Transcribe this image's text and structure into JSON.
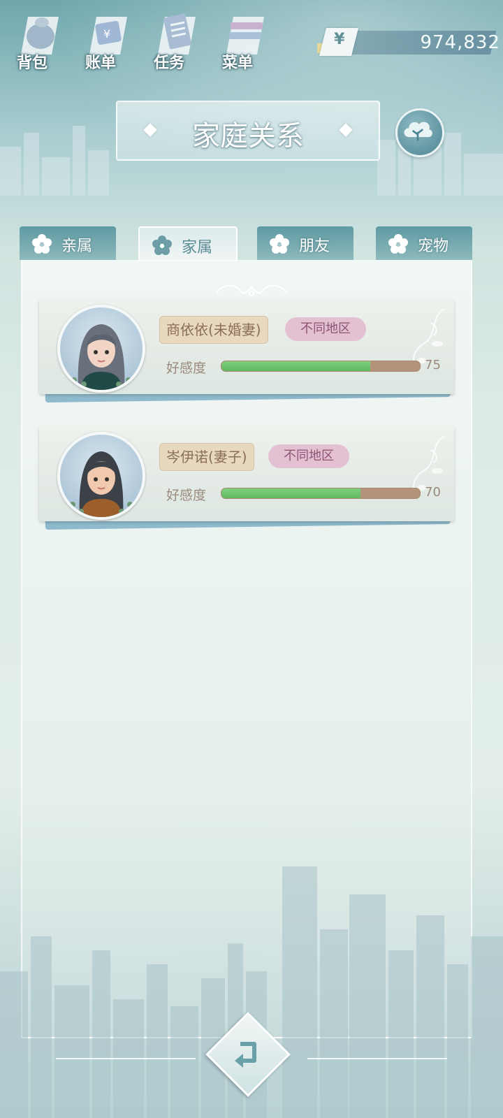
{
  "top_menu": [
    {
      "label": "背包",
      "icon": "backpack-icon"
    },
    {
      "label": "账单",
      "icon": "bill-icon"
    },
    {
      "label": "任务",
      "icon": "task-icon"
    },
    {
      "label": "菜单",
      "icon": "menu-icon"
    }
  ],
  "currency": {
    "symbol": "¥",
    "amount": "974,832"
  },
  "title": "家庭关系",
  "tabs": [
    {
      "label": "亲属",
      "active": false
    },
    {
      "label": "家属",
      "active": true
    },
    {
      "label": "朋友",
      "active": false
    },
    {
      "label": "宠物",
      "active": false
    }
  ],
  "members": [
    {
      "name": "商依依(未婚妻)",
      "region": "不同地区",
      "affinity_label": "好感度",
      "affinity": 75
    },
    {
      "name": "岑伊诺(妻子)",
      "region": "不同地区",
      "affinity_label": "好感度",
      "affinity": 70
    }
  ],
  "colors": {
    "affinity_fill": "#66bf66",
    "affinity_track": "#b3937a",
    "region_tag": "#e3c1d3",
    "name_tag": "#e8d8bf"
  }
}
